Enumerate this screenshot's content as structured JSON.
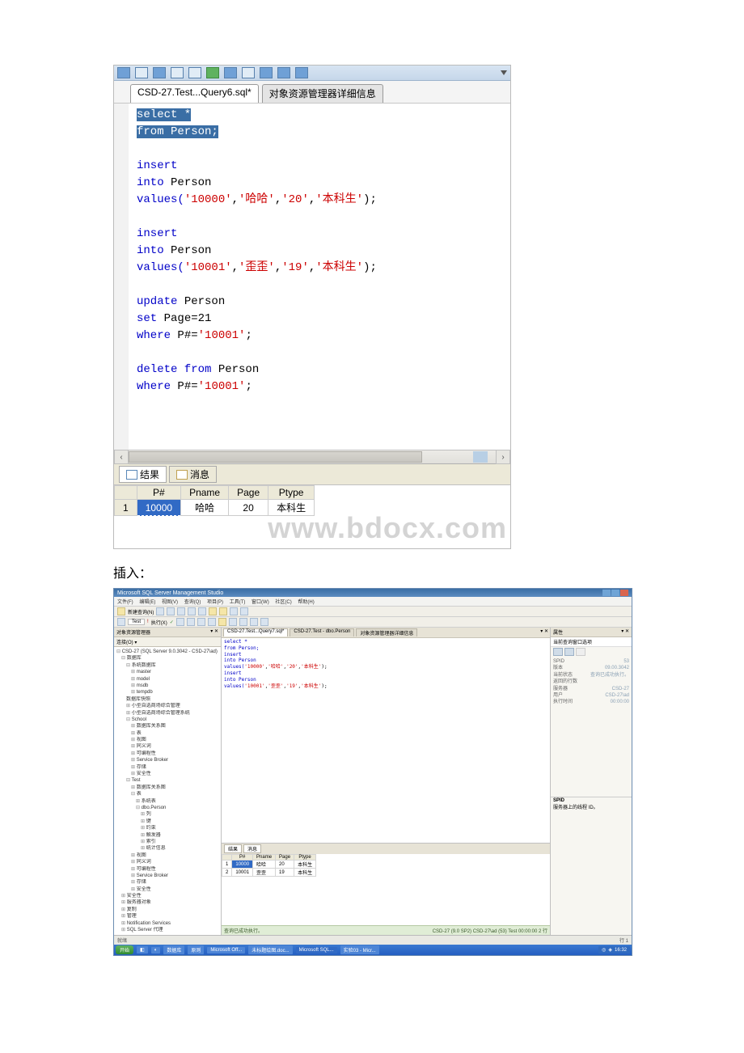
{
  "capture1": {
    "tab_active": "CSD-27.Test...Query6.sql*",
    "tab_other": "对象资源管理器详细信息",
    "code": {
      "l1": "select *",
      "l2": "from Person;",
      "insert1_kw": "insert",
      "into1": "into",
      "person": "Person",
      "v1a": "values(",
      "v1b": "'10000'",
      "v1c": ",",
      "v1d": "'哈哈'",
      "v1e": ",",
      "v1f": "'20'",
      "v1g": ",",
      "v1h": "'本科生'",
      "v1i": ");",
      "v2b": "'10001'",
      "v2d": "'歪歪'",
      "v2f": "'19'",
      "upd": "update",
      "setkw": "set",
      "setexpr": "Page=21",
      "where": "where",
      "whereexpr1": "P#=",
      "wherev1": "'10001'",
      "semico": ";",
      "del": "delete from"
    },
    "results_tab": "结果",
    "messages_tab": "消息",
    "cols": {
      "c0": "",
      "c1": "P#",
      "c2": "Pname",
      "c3": "Page",
      "c4": "Ptype"
    },
    "row1": {
      "n": "1",
      "c1": "10000",
      "c2": "哈哈",
      "c3": "20",
      "c4": "本科生"
    },
    "watermark": "www.bdocx.com"
  },
  "caption": "插入：",
  "thumb": {
    "title": "Microsoft SQL Server Management Studio",
    "menu": {
      "m1": "文件(F)",
      "m2": "编辑(E)",
      "m3": "视图(V)",
      "m4": "查询(Q)",
      "m5": "项目(P)",
      "m6": "工具(T)",
      "m7": "窗口(W)",
      "m8": "社区(C)",
      "m9": "帮助(H)"
    },
    "tb1": "新建查询(N)",
    "tb2": "Test",
    "tb3": "执行(X)",
    "left": {
      "hdr": "对象资源管理器",
      "hdr2": "连接(O) ▾",
      "root": "CSD-27 (SQL Server 9.0.3042 - CSD-27\\ad)",
      "n1": "数据库",
      "n2": "系统数据库",
      "n3": "master",
      "n4": "model",
      "n5": "msdb",
      "n6": "tempdb",
      "n7": "数据库快照",
      "n8": "小型自选商场综合管理",
      "n9": "小型自选商场综合管理系统",
      "n10": "School",
      "n11": "数据库关系图",
      "n12": "表",
      "n13": "视图",
      "n14": "同义词",
      "n15": "可编程性",
      "n16": "Service Broker",
      "n17": "存储",
      "n18": "安全性",
      "n19": "Test",
      "n20": "数据库关系图",
      "n21": "表",
      "n22": "系统表",
      "n23": "dbo.Person",
      "n24": "列",
      "n25": "键",
      "n26": "约束",
      "n27": "触发器",
      "n28": "索引",
      "n29": "统计信息",
      "n30": "视图",
      "n31": "同义词",
      "n32": "可编程性",
      "n33": "Service Broker",
      "n34": "存储",
      "n35": "安全性",
      "n36": "安全性",
      "n37": "服务器对象",
      "n38": "复制",
      "n39": "管理",
      "n40": "Notification Services",
      "n41": "SQL Server 代理"
    },
    "center": {
      "tab1": "CSD-27.Test...Query7.sql*",
      "tab2": "CSD-27.Test - dbo.Person",
      "tab3": "对象资源管理器详细信息",
      "code": {
        "l1": "select *",
        "l2": "from Person;",
        "l3": "insert",
        "l4": "into Person",
        "l5a": "values(",
        "l5b": "'10000'",
        "l5c": ",",
        "l5d": "'哈哈'",
        "l5e": ",",
        "l5f": "'20'",
        "l5g": ",",
        "l5h": "'本科生'",
        "l5i": ");",
        "l6": "insert",
        "l7": "into Person",
        "l8b": "'10001'",
        "l8d": "'歪歪'",
        "l8f": "'19'"
      },
      "rtab1": "结果",
      "rtab2": "消息",
      "cols": {
        "c1": "P#",
        "c2": "Pname",
        "c3": "Page",
        "c4": "Ptype"
      },
      "row1": {
        "n": "1",
        "c1": "10000",
        "c2": "哈哈",
        "c3": "20",
        "c4": "本科生"
      },
      "row2": {
        "n": "2",
        "c1": "10001",
        "c2": "歪歪",
        "c3": "19",
        "c4": "本科生"
      },
      "statusL": "查询已成功执行。",
      "statusR": "CSD-27 (9.0 SP2)   CSD-27\\ad (53)   Test   00:00:00   2 行"
    },
    "right": {
      "hdr": "属性",
      "subhdr": "当前查询窗口选项",
      "p1n": "SPID",
      "p1v": "53",
      "p2n": "版本",
      "p2v": "09.00.3042",
      "p3n": "当前状态",
      "p3v": "查询已成功执行。",
      "p4n": "返回的行数",
      "p4v": "",
      "p5n": "服务器",
      "p5v": "CSD-27",
      "p6n": "用户",
      "p6v": "CSD-27\\ad",
      "p7n": "执行时间",
      "p7v": "00:00:00",
      "foot1": "SPID",
      "foot2": "服务器上的线程 ID。"
    },
    "lowbar": "就绪",
    "lowbarR": "行 1",
    "taskbar": {
      "start": "开始",
      "b1": "数据库",
      "b2": "原则",
      "b3": "Microsoft Off...",
      "b4": "未标题绘图.doc...",
      "b5": "Microsoft SQL...",
      "b6": "实验03 - Micr...",
      "tray": "16:32"
    }
  }
}
